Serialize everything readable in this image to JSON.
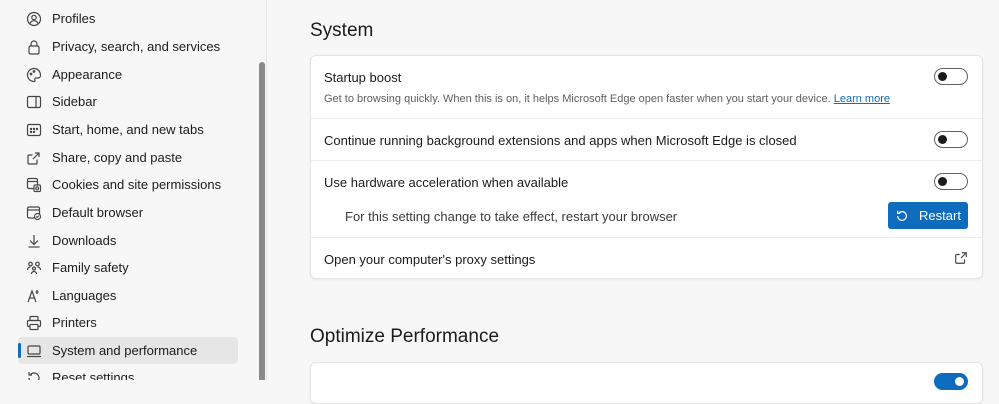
{
  "sidebar": {
    "items": [
      {
        "label": "Profiles",
        "icon": "profile-icon"
      },
      {
        "label": "Privacy, search, and services",
        "icon": "lock-icon"
      },
      {
        "label": "Appearance",
        "icon": "appearance-icon"
      },
      {
        "label": "Sidebar",
        "icon": "sidebar-icon"
      },
      {
        "label": "Start, home, and new tabs",
        "icon": "home-tabs-icon"
      },
      {
        "label": "Share, copy and paste",
        "icon": "share-icon"
      },
      {
        "label": "Cookies and site permissions",
        "icon": "cookies-icon"
      },
      {
        "label": "Default browser",
        "icon": "default-browser-icon"
      },
      {
        "label": "Downloads",
        "icon": "download-icon"
      },
      {
        "label": "Family safety",
        "icon": "family-icon"
      },
      {
        "label": "Languages",
        "icon": "languages-icon"
      },
      {
        "label": "Printers",
        "icon": "printer-icon"
      },
      {
        "label": "System and performance",
        "icon": "system-icon",
        "active": true
      },
      {
        "label": "Reset settings",
        "icon": "reset-icon"
      }
    ]
  },
  "main": {
    "system_title": "System",
    "startup_boost": {
      "title": "Startup boost",
      "desc": "Get to browsing quickly. When this is on, it helps Microsoft Edge open faster when you start your device.",
      "link": "Learn more",
      "enabled": false
    },
    "background_ext": {
      "title": "Continue running background extensions and apps when Microsoft Edge is closed",
      "enabled": false
    },
    "hw_accel": {
      "title": "Use hardware acceleration when available",
      "enabled": false,
      "restart_note": "For this setting change to take effect, restart your browser",
      "restart_label": "Restart"
    },
    "proxy": {
      "title": "Open your computer's proxy settings"
    },
    "optimize_title": "Optimize Performance"
  },
  "colors": {
    "accent": "#0f6cbd"
  }
}
